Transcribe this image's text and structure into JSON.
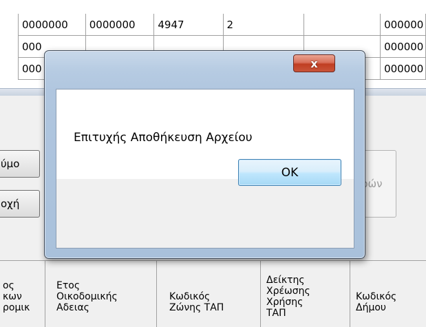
{
  "grid_top": {
    "rows": [
      [
        "0000000",
        "0000000",
        "4947",
        "2",
        "",
        "000000"
      ],
      [
        "000",
        "",
        "",
        "",
        "",
        "000000"
      ],
      [
        "000",
        "",
        "",
        "",
        "",
        "000000"
      ]
    ]
  },
  "panel": {
    "btn1_label": "ύμο",
    "btn2_label": "οχή",
    "btn3_label": "ρών"
  },
  "grid_bottom": {
    "headers": [
      "ος\nκων\nρομικ",
      "Ετος\nΟικοδομικής\nΑδειας",
      "Κωδικός\nΖώνης ΤΑΠ",
      "Δείκτης\nΧρέωσης\nΧρήσης\nΤΑΠ",
      "Κωδικός\nΔήμου"
    ]
  },
  "dialog": {
    "close_symbol": "x",
    "message": "Επιτυχής Αποθήκευση Αρχείου",
    "ok_label": "OK"
  }
}
